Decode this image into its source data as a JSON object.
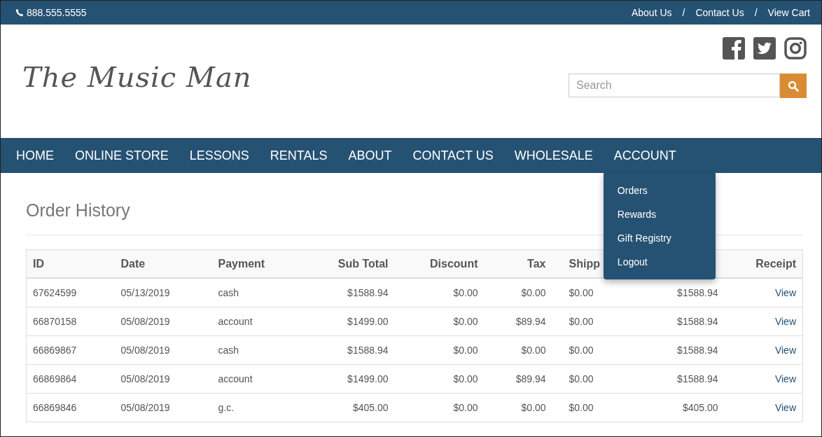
{
  "top_bar": {
    "phone": "888.555.5555",
    "links": [
      "About Us",
      "Contact Us",
      "View Cart"
    ],
    "separator": "/"
  },
  "header": {
    "logo": "The Music Man",
    "search": {
      "placeholder": "Search"
    }
  },
  "nav": {
    "items": [
      {
        "label": "HOME",
        "selected": false
      },
      {
        "label": "ONLINE STORE",
        "selected": false
      },
      {
        "label": "LESSONS",
        "selected": false
      },
      {
        "label": "RENTALS",
        "selected": false
      },
      {
        "label": "ABOUT",
        "selected": false
      },
      {
        "label": "CONTACT US",
        "selected": false
      },
      {
        "label": "WHOLESALE",
        "selected": false
      },
      {
        "label": "ACCOUNT",
        "selected": true
      }
    ],
    "dropdown": [
      "Orders",
      "Rewards",
      "Gift Registry",
      "Logout"
    ]
  },
  "page_title": "Order History",
  "table": {
    "columns": [
      {
        "label": "ID",
        "kind": "text"
      },
      {
        "label": "Date",
        "kind": "text"
      },
      {
        "label": "Payment",
        "kind": "text"
      },
      {
        "label": "Sub Total",
        "kind": "money"
      },
      {
        "label": "Discount",
        "kind": "money"
      },
      {
        "label": "Tax",
        "kind": "money"
      },
      {
        "label": "Shipp",
        "kind": "covered"
      },
      {
        "kind": "money"
      },
      {
        "label": "Receipt",
        "kind": "link"
      }
    ],
    "rows": [
      [
        "67624599",
        "05/13/2019",
        "cash",
        "$1588.94",
        "$0.00",
        "$0.00",
        "$0.00",
        "$1588.94",
        "View"
      ],
      [
        "66870158",
        "05/08/2019",
        "account",
        "$1499.00",
        "$0.00",
        "$89.94",
        "$0.00",
        "$1588.94",
        "View"
      ],
      [
        "66869867",
        "05/08/2019",
        "cash",
        "$1588.94",
        "$0.00",
        "$0.00",
        "$0.00",
        "$1588.94",
        "View"
      ],
      [
        "66869864",
        "05/08/2019",
        "account",
        "$1499.00",
        "$0.00",
        "$89.94",
        "$0.00",
        "$1588.94",
        "View"
      ],
      [
        "66869846",
        "05/08/2019",
        "g.c.",
        "$405.00",
        "$0.00",
        "$0.00",
        "$0.00",
        "$405.00",
        "View"
      ]
    ]
  }
}
